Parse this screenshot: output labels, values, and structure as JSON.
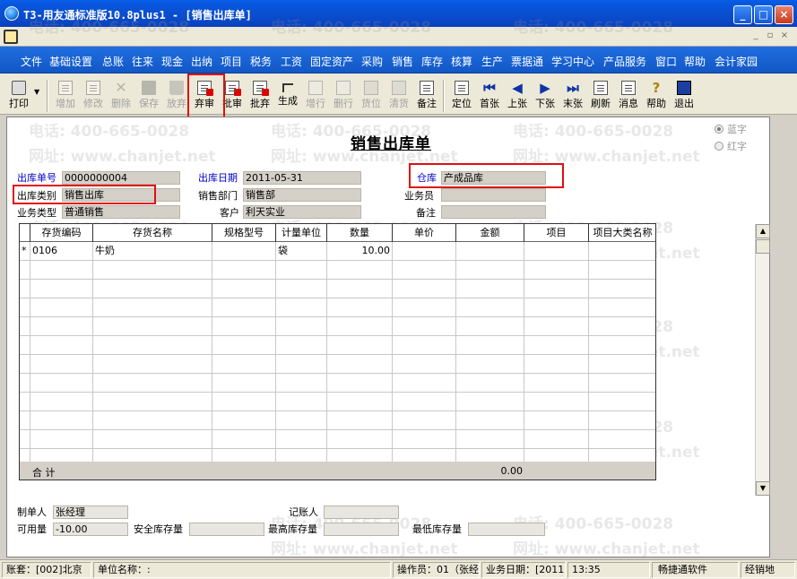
{
  "window": {
    "title": "T3-用友通标准版10.8plus1 - [销售出库单]",
    "minimize_glyph": "_",
    "maximize_glyph": "□",
    "close_glyph": "×"
  },
  "mdi": {
    "minimize_glyph": "_",
    "restore_glyph": "▫",
    "close_glyph": "×"
  },
  "menu": [
    "文件",
    "基础设置",
    "总账",
    "往来",
    "现金",
    "出纳",
    "项目",
    "税务",
    "工资",
    "固定资产",
    "采购",
    "销售",
    "库存",
    "核算",
    "生产",
    "票据通",
    "学习中心",
    "产品服务",
    "窗口",
    "帮助",
    "会计家园"
  ],
  "toolbar": {
    "print": "打印",
    "add": "增加",
    "modify": "修改",
    "delete": "删除",
    "save": "保存",
    "abandon": "放弃",
    "unaudit": "弃审",
    "batch_audit": "批审",
    "batch_unaudit": "批弃",
    "generate": "生成",
    "add_row": "增行",
    "delete_row": "删行",
    "goods_position": "货位",
    "clear_goods": "清货",
    "remark": "备注",
    "locate": "定位",
    "first": "首张",
    "prev": "上张",
    "next": "下张",
    "last": "末张",
    "refresh": "刷新",
    "message": "消息",
    "help": "帮助",
    "exit": "退出"
  },
  "form": {
    "title": "销售出库单",
    "color_blue": "蓝字",
    "color_red": "红字",
    "fields": {
      "doc_no_label": "出库单号",
      "doc_no": "0000000004",
      "date_label": "出库日期",
      "date": "2011-05-31",
      "warehouse_label": "仓库",
      "warehouse": "产成品库",
      "type_label": "出库类别",
      "type": "销售出库",
      "dept_label": "销售部门",
      "dept": "销售部",
      "clerk_label": "业务员",
      "clerk": "",
      "biz_type_label": "业务类型",
      "biz_type": "普通销售",
      "customer_label": "客户",
      "customer": "利天实业",
      "note_label": "备注",
      "note": ""
    },
    "grid": {
      "columns": [
        "存货编码",
        "存货名称",
        "规格型号",
        "计量单位",
        "数量",
        "单价",
        "金额",
        "项目",
        "项目大类名称"
      ],
      "rows": [
        {
          "marker": "*",
          "code": "0106",
          "name": "牛奶",
          "spec": "",
          "unit": "袋",
          "qty": "10.00",
          "price": "",
          "amount": "",
          "project": "",
          "category": ""
        }
      ],
      "total_label": "合  计",
      "total_amount": "0.00"
    },
    "footer": {
      "maker_label": "制单人",
      "maker": "张经理",
      "bookkeeper_label": "记账人",
      "bookkeeper": "",
      "available_label": "可用量",
      "available": "-10.00",
      "safe_stock_label": "安全库存量",
      "safe_stock": "",
      "max_stock_label": "最高库存量",
      "max_stock": "",
      "min_stock_label": "最低库存量",
      "min_stock": ""
    }
  },
  "status": {
    "account": "账套：[002]北京",
    "unit": "单位名称：:",
    "operator": "操作员：01（张经",
    "biz_date": "业务日期：[2011",
    "time": "13:35",
    "brand": "畅捷通软件",
    "region": "经销地"
  },
  "watermark": {
    "phone": "电话: 400-665-0028",
    "site": "网址: www.chanjet.net"
  }
}
